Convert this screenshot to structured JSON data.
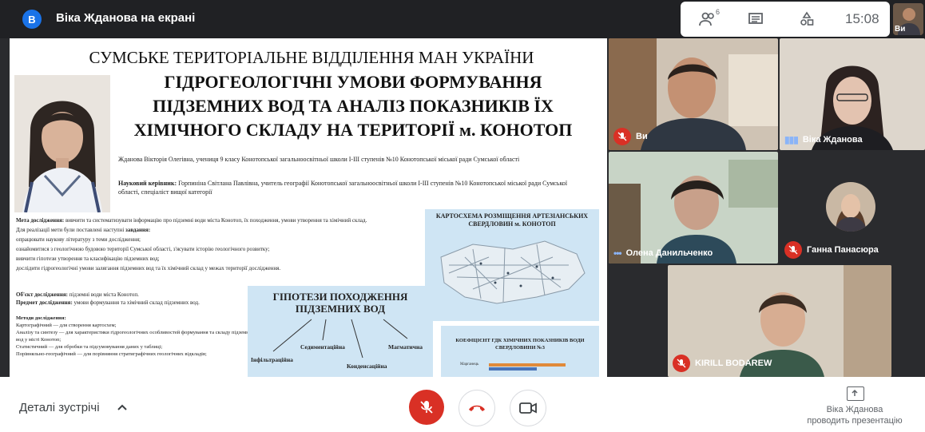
{
  "header": {
    "presenter_initial": "В",
    "title": "Віка Жданова на екрані",
    "participant_count": "6",
    "time": "15:08",
    "self_label": "Ви"
  },
  "slide": {
    "org": "СУМСЬКЕ ТЕРИТОРІАЛЬНЕ ВІДДІЛЕННЯ МАН УКРАЇНИ",
    "title_l1": "ГІДРОГЕОЛОГІЧНІ УМОВИ ФОРМУВАННЯ",
    "title_l2": "ПІДЗЕМНИХ ВОД ТА АНАЛІЗ ПОКАЗНИКІВ ЇХ",
    "title_l3": "ХІМІЧНОГО СКЛАДУ НА ТЕРИТОРІЇ м. КОНОТОП",
    "author": "Жданова Вікторія Олегівна, учениця 9 класу Конотопської загальноосвітньої школи І-ІІІ ступенів №10 Конотопської міської ради Сумської області",
    "advisor_label": "Науковий керівник:",
    "advisor": "Горпиніна Світлана Павлівна, учитель географії Конотопської загальноосвітньої школи І-ІІІ ступенів №10 Конотопської міської ради Сумської області, спеціаліст вищої категорії",
    "aim_label": "Мета дослідження:",
    "aim": "вивчити та систематизувати інформацію про підземні води міста Конотоп, їх походження, умови утворення та хімічний склад.",
    "tasks_intro": "Для реалізації мети були поставлені наступні",
    "tasks_label": "завдання:",
    "tasks": [
      "опрацювати наукову літературу з теми дослідження;",
      "ознайомитися з геологічною будовою території Сумської області, з'ясувати історію геологічного розвитку;",
      "вивчити гіпотези утворення та класифікацію підземних вод;",
      "дослідити гідрогеологічні умови залягання підземних вод та їх хімічний склад у межах території дослідження."
    ],
    "object_label": "Об'єкт дослідження:",
    "object": "підземні води міста Конотоп.",
    "subject_label": "Предмет дослідження:",
    "subject": "умови формування та хімічний склад підземних вод.",
    "methods_label": "Методи дослідження:",
    "methods": [
      "Картографічний — для створення картосхем;",
      "Аналізу та синтезу — для характеристики гідрогеологічних особливостей формування та складу підземних вод у місті Конотоп;",
      "Статистичний — для обробки та підсумовування даних у таблиці;",
      "Порівняльно-географічний — для порівняння стратиграфічних геологічних відкладів;"
    ],
    "map_title": "КАРТОСХЕМА РОЗМІЩЕННЯ АРТЕЗІАНСЬКИХ СВЕРДЛОВИН м. КОНОТОП",
    "hyp_title": "ГІПОТЕЗИ ПОХОДЖЕННЯ ПІДЗЕМНИХ ВОД",
    "hyp_items": [
      "Інфільтраційна",
      "Седиментаційна",
      "Конденсаційна",
      "Магматична"
    ],
    "coef_title": "КОЕФІЦІЄНТ ГДК ХІМІЧНИХ ПОКАЗНИКІВ ВОДИ СВЕРДЛОВИНИ №3",
    "coef_row": "Марганець"
  },
  "participants": [
    {
      "name": "Ви",
      "mic": "off"
    },
    {
      "name": "Віка Жданова",
      "mic": "speaking"
    },
    {
      "name": "Олена Данильченко",
      "mic": "speaking"
    },
    {
      "name": "Ганна Панасюра",
      "mic": "off"
    },
    {
      "name": "KIRILL BODAREW",
      "mic": "off"
    }
  ],
  "footer": {
    "details": "Деталі зустрічі",
    "presenting_name": "Віка Жданова",
    "presenting_text": "проводить презентацію"
  },
  "colors": {
    "end_call": "#d93025",
    "accent": "#1a73e8"
  }
}
